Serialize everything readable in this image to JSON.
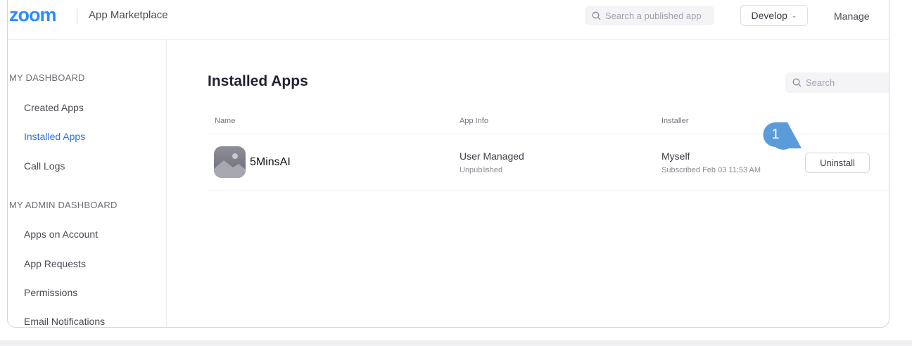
{
  "header": {
    "logo": "zoom",
    "title": "App Marketplace",
    "search_placeholder": "Search a published app",
    "develop_label": "Develop",
    "manage_label": "Manage"
  },
  "sidebar": {
    "sections": [
      {
        "heading": "MY DASHBOARD",
        "items": [
          {
            "label": "Created Apps",
            "active": false
          },
          {
            "label": "Installed Apps",
            "active": true
          },
          {
            "label": "Call Logs",
            "active": false
          }
        ]
      },
      {
        "heading": "MY ADMIN DASHBOARD",
        "items": [
          {
            "label": "Apps on Account",
            "active": false
          },
          {
            "label": "App Requests",
            "active": false
          },
          {
            "label": "Permissions",
            "active": false
          },
          {
            "label": "Email Notifications",
            "active": false
          }
        ]
      }
    ]
  },
  "main": {
    "title": "Installed Apps",
    "search_placeholder": "Search",
    "columns": [
      "Name",
      "App Info",
      "Installer"
    ],
    "rows": [
      {
        "name": "5MinsAI",
        "app_info": "User Managed",
        "app_info_sub": "Unpublished",
        "installer": "Myself",
        "installer_sub": "Subscribed Feb 03 11:53 AM",
        "action": "Uninstall"
      }
    ]
  },
  "annotation": {
    "step_number": "1",
    "color": "#5b9bd9"
  },
  "colors": {
    "brand": "#2d8cff",
    "active_link": "#2d6fe0"
  }
}
